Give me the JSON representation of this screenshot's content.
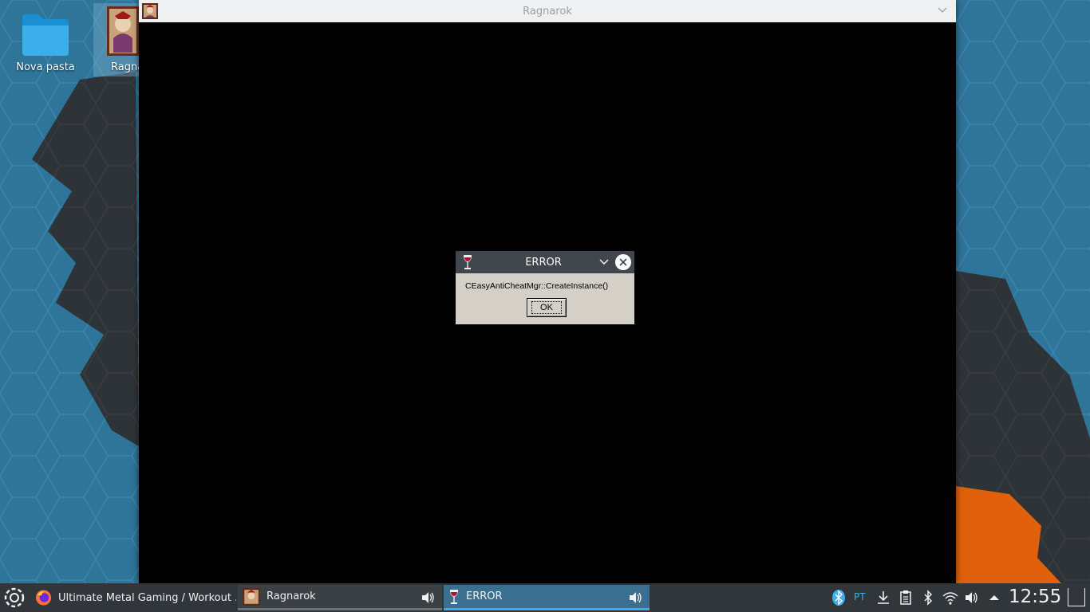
{
  "desktop": {
    "icons": [
      {
        "label": "Nova pasta",
        "icon": "folder-icon"
      },
      {
        "label": "Ragnarok",
        "icon": "ragnarok-app-icon"
      }
    ]
  },
  "window": {
    "title": "Ragnarok",
    "icon": "ragnarok-app-icon"
  },
  "dialog": {
    "title": "ERROR",
    "message": "CEasyAntiCheatMgr::CreateInstance()",
    "ok_label": "OK",
    "icon": "wine-glass-icon"
  },
  "taskbar": {
    "tasks": [
      {
        "label": "Ultimate Metal Gaming / Workout ...",
        "icon": "firefox-icon"
      },
      {
        "label": "Ragnarok",
        "icon": "ragnarok-app-icon"
      },
      {
        "label": "ERROR",
        "icon": "wine-glass-icon",
        "active": true
      }
    ],
    "tray": {
      "language": "PT",
      "clock": "12:55"
    }
  },
  "colors": {
    "accent": "#3daee9",
    "panel": "#31363b",
    "dialog_bg": "#d4d0c8",
    "orange": "#e85f0a"
  }
}
